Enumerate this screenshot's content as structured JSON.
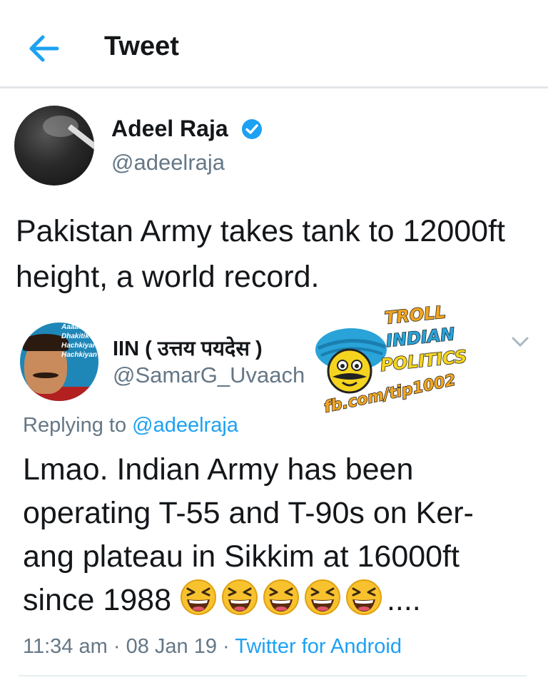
{
  "header": {
    "title": "Tweet"
  },
  "tweet": {
    "author_name": "Adeel Raja",
    "author_handle": "@adeelraja",
    "text": "Pakistan Army takes tank to 12000ft height, a world record."
  },
  "reply": {
    "author_name": "IIN ( उत्तय पयदेस )",
    "author_handle": "@SamarG_Uvaach",
    "avatar_caption": [
      "Aaaao",
      "Dhakitik",
      "Hachkiyan",
      "Hachkiyan"
    ],
    "replying_prefix": "Replying to",
    "replying_to": "@adeelraja",
    "text_lines": [
      "Lmao. Indian Army has been",
      "operating T-55 and T-90s on Ker-",
      "ang plateau in Sikkim at 16000ft"
    ],
    "last_line_text": "since 1988",
    "last_line_suffix": "....",
    "emoji_icon": "laughing-squint-face",
    "emoji_count": 5,
    "time": "11:34 am",
    "date": "08 Jan 19",
    "separator": "·",
    "source": "Twitter for Android"
  },
  "watermark": {
    "lines": [
      "TROLL",
      "INDIAN",
      "POLITICS"
    ],
    "url": "fb.com/tip1002"
  },
  "colors": {
    "accent": "#1da1f2",
    "secondary_text": "#657786",
    "primary_text": "#14171a"
  }
}
